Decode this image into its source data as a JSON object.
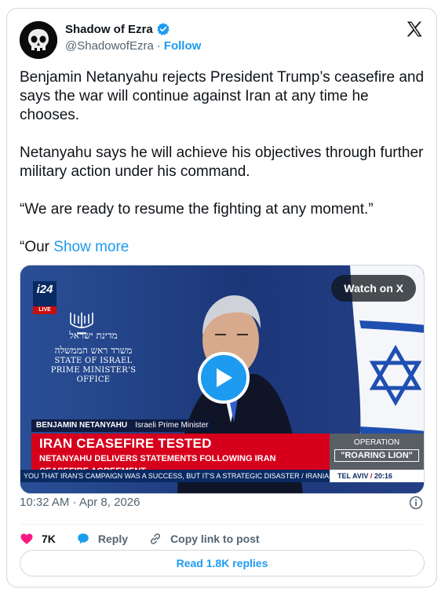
{
  "author": {
    "name": "Shadow of Ezra",
    "handle": "@ShadowofEzra",
    "separator": "·",
    "follow_label": "Follow"
  },
  "tweet": {
    "paragraph1": "Benjamin Netanyahu rejects President Trump’s ceasefire and says the war will continue against Iran at any time he chooses.",
    "paragraph2": "Netanyahu says he will achieve his objectives through further military action under his command.",
    "paragraph3": "“We are ready to resume the fighting at any moment.”",
    "paragraph4_start": "“Our ",
    "show_more": "Show more"
  },
  "media": {
    "watch_label": "Watch on X",
    "channel_logo": "i24",
    "live_label": "LIVE",
    "gov_hebrew_1": "מדינת ישראל",
    "gov_hebrew_2": "משרד ראש הממשלה",
    "gov_english_1": "STATE OF ISRAEL",
    "gov_english_2": "PRIME MINISTER'S OFFICE",
    "speaker_name": "BENJAMIN NETANYAHU",
    "speaker_title": "Israeli Prime Minister",
    "headline": "IRAN CEASEFIRE TESTED",
    "subheadline": "NETANYAHU DELIVERS STATEMENTS FOLLOWING IRAN CEASEFIRE AGREEMENT",
    "operation_label": "OPERATION",
    "operation_name": "\"ROARING LION\"",
    "ticker": "YOU THAT IRAN'S CAMPAIGN WAS A SUCCESS, BUT IT'S A STRATEGIC DISASTER  /  IRANIAN STATE MEDIA SAY",
    "location": "TEL AVIV",
    "time": "20:16"
  },
  "meta": {
    "timestamp": "10:32 AM · Apr 8, 2026"
  },
  "actions": {
    "likes": "7K",
    "reply_label": "Reply",
    "copy_label": "Copy link to post",
    "read_replies": "Read 1.8K replies"
  },
  "colors": {
    "accent": "#1d9bf0",
    "like": "#f91880",
    "text_secondary": "#536471",
    "news_red": "#d6001c"
  },
  "icons": [
    "verified-badge-icon",
    "x-logo-icon",
    "play-icon",
    "info-icon",
    "heart-icon",
    "reply-bubble-icon",
    "link-icon"
  ]
}
